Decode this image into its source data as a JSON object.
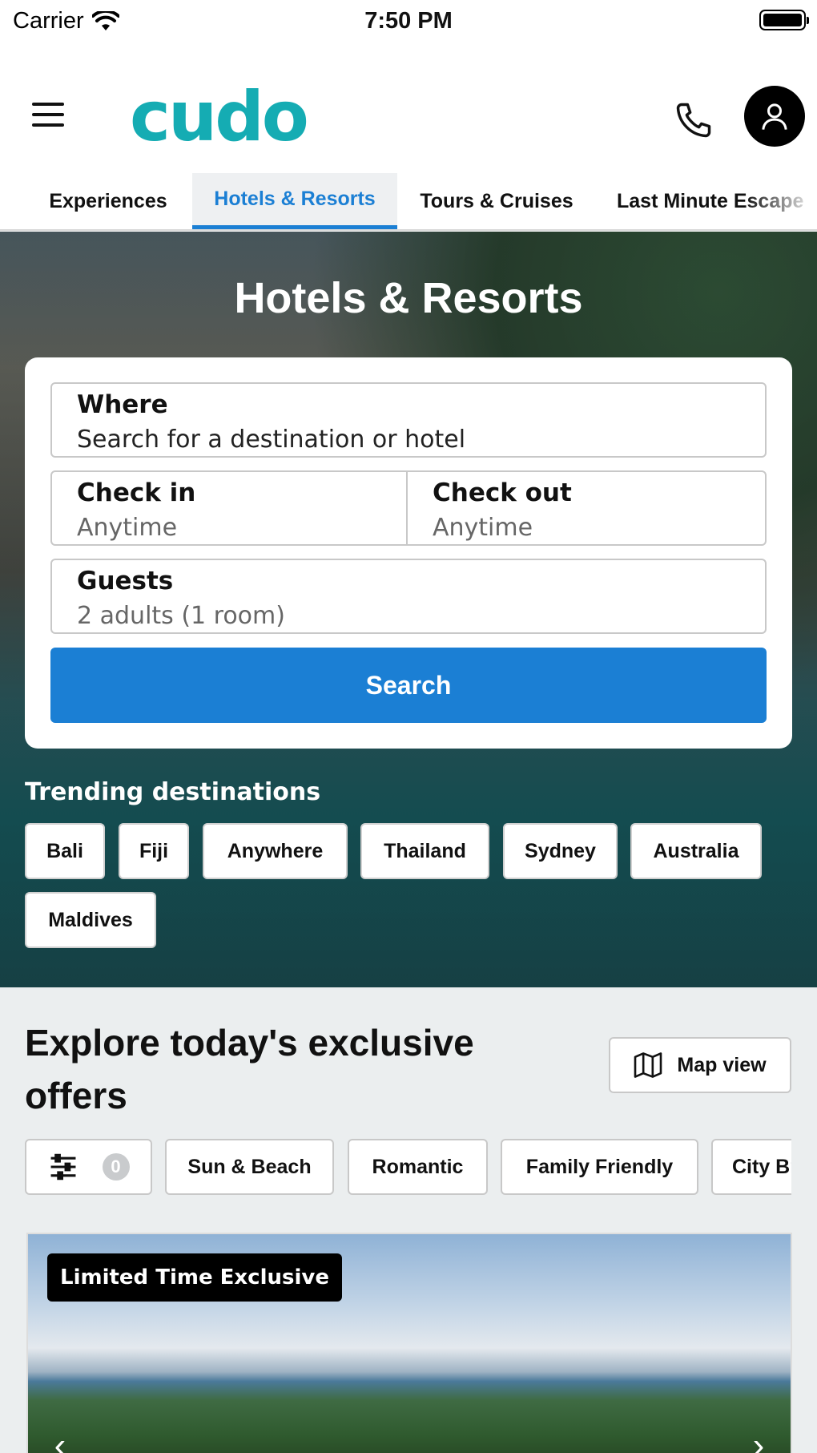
{
  "status_bar": {
    "carrier": "Carrier",
    "time": "7:50 PM"
  },
  "header": {
    "logo": "cudo"
  },
  "tabs": [
    {
      "label": "Experiences",
      "active": false
    },
    {
      "label": "Hotels & Resorts",
      "active": true
    },
    {
      "label": "Tours & Cruises",
      "active": false
    },
    {
      "label": "Last Minute Escape",
      "active": false
    }
  ],
  "hero": {
    "title": "Hotels & Resorts",
    "search": {
      "where_label": "Where",
      "where_placeholder": "Search for a destination or hotel",
      "checkin_label": "Check in",
      "checkin_value": "Anytime",
      "checkout_label": "Check out",
      "checkout_value": "Anytime",
      "guests_label": "Guests",
      "guests_value": "2 adults (1 room)",
      "button": "Search"
    },
    "trending_title": "Trending destinations",
    "trending": [
      "Bali",
      "Fiji",
      "Anywhere",
      "Thailand",
      "Sydney",
      "Australia",
      "Maldives"
    ]
  },
  "explore": {
    "title": "Explore today's exclusive offers",
    "map_button": "Map view",
    "filter_count": "0",
    "filters": [
      "Sun & Beach",
      "Romantic",
      "Family Friendly",
      "City Breaks"
    ],
    "offer_badge": "Limited Time Exclusive"
  },
  "colors": {
    "brand": "#15acb3",
    "accent": "#1b7fd4",
    "badge": "#000000"
  }
}
